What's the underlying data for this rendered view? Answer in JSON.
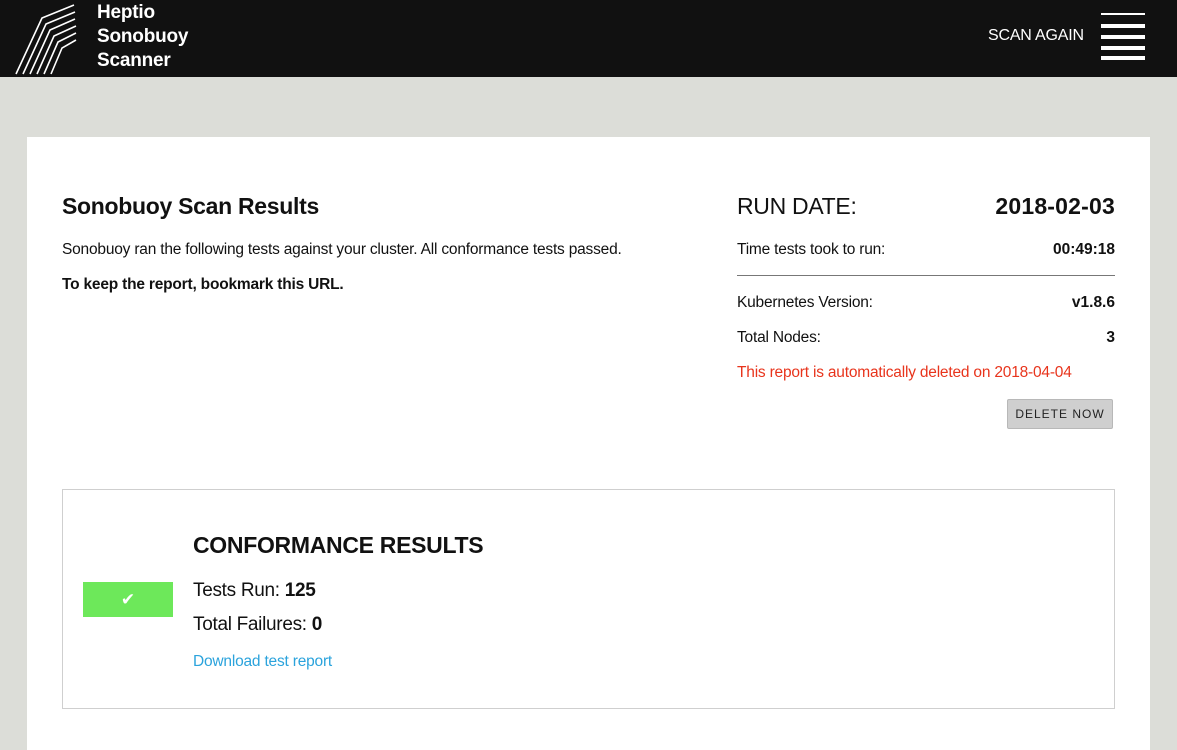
{
  "header": {
    "brand_lines": [
      "Heptio",
      "Sonobuoy",
      "Scanner"
    ],
    "scan_again_label": "SCAN AGAIN"
  },
  "report": {
    "title": "Sonobuoy Scan Results",
    "description": "Sonobuoy ran the following tests against your cluster. All conformance tests passed.",
    "bookmark_note": "To keep the report, bookmark this URL."
  },
  "run_info": {
    "run_date_label": "RUN DATE:",
    "run_date": "2018-02-03",
    "duration_label": "Time tests took to run:",
    "duration": "00:49:18",
    "k8s_version_label": "Kubernetes Version:",
    "k8s_version": "v1.8.6",
    "total_nodes_label": "Total Nodes:",
    "total_nodes": "3",
    "deletion_notice": "This report is automatically deleted on 2018-04-04",
    "delete_button_label": "DELETE NOW"
  },
  "conformance": {
    "title": "CONFORMANCE RESULTS",
    "status_icon": "check-mark",
    "status_glyph": "✔",
    "tests_run_label": "Tests Run:",
    "tests_run": "125",
    "failures_label": "Total Failures:",
    "failures": "0",
    "download_label": "Download test report"
  },
  "colors": {
    "header_bg": "#111111",
    "page_bg": "#dcddd8",
    "pass_green": "#6de85a",
    "warning_red": "#e8341c",
    "link_blue": "#2ba3dc"
  }
}
